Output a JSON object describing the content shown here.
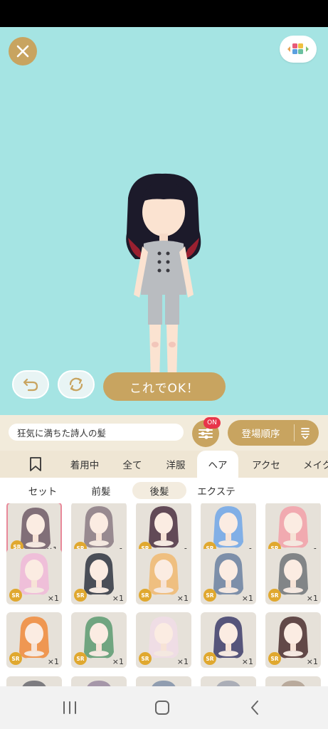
{
  "app": {
    "accent_color": "#c8a460",
    "stage_color": "#a5e4e3"
  },
  "stage": {
    "close_icon": "close-icon",
    "grid_icon": "colored-grid-icon",
    "ok_label": "これでOK！",
    "undo_icon": "undo-icon",
    "reset_icon": "rotate-icon"
  },
  "info": {
    "item_name": "狂気に満ちた詩人の髪",
    "filter_badge": "ON",
    "sort_label": "登場順序"
  },
  "categories": [
    {
      "label": "",
      "icon": "bookmark-icon"
    },
    {
      "label": "着用中"
    },
    {
      "label": "全て"
    },
    {
      "label": "洋服"
    },
    {
      "label": "ヘア"
    },
    {
      "label": "アクセ"
    },
    {
      "label": "メイク"
    }
  ],
  "active_category": "ヘア",
  "subcategories": [
    {
      "label": "セット"
    },
    {
      "label": "前髪"
    },
    {
      "label": "後髪"
    },
    {
      "label": "エクステ"
    }
  ],
  "active_subcategory": "後髪",
  "items": [
    {
      "rarity": "SR",
      "qty": "×1",
      "hair": "#6e5a66",
      "selected": true
    },
    {
      "rarity": "SR",
      "qty": "×1",
      "hair": "#8a7a82"
    },
    {
      "rarity": "SR",
      "qty": "×1",
      "hair": "#4a2f40"
    },
    {
      "rarity": "SR",
      "qty": "×1",
      "hair": "#6ea6e8"
    },
    {
      "rarity": "SR",
      "qty": "×1",
      "hair": "#f2a0a8"
    },
    {
      "rarity": "SR",
      "qty": "×1",
      "hair": "#f0b8d8"
    },
    {
      "rarity": "SR",
      "qty": "×1",
      "hair": "#2e3440"
    },
    {
      "rarity": "SR",
      "qty": "×1",
      "hair": "#f0b870"
    },
    {
      "rarity": "SR",
      "qty": "×1",
      "hair": "#6a80a0"
    },
    {
      "rarity": "SR",
      "qty": "×1",
      "hair": "#707478"
    },
    {
      "rarity": "SR",
      "qty": "×1",
      "hair": "#f08a3a"
    },
    {
      "rarity": "SR",
      "qty": "×1",
      "hair": "#5a9a70"
    },
    {
      "rarity": "SR",
      "qty": "×1",
      "hair": "#f0dce6"
    },
    {
      "rarity": "SR",
      "qty": "×1",
      "hair": "#3c3c6a"
    },
    {
      "rarity": "SR",
      "qty": "×1",
      "hair": "#4a2e2e"
    },
    {
      "rarity": "",
      "qty": "",
      "hair": "#6a6a70"
    },
    {
      "rarity": "",
      "qty": "",
      "hair": "#9a8aa0"
    },
    {
      "rarity": "",
      "qty": "",
      "hair": "#8090a8"
    },
    {
      "rarity": "",
      "qty": "",
      "hair": "#a0a4b0"
    },
    {
      "rarity": "",
      "qty": "",
      "hair": "#b0a090"
    }
  ],
  "nav": {
    "recents_icon": "recents-icon",
    "home_icon": "home-icon",
    "back_icon": "back-icon"
  }
}
